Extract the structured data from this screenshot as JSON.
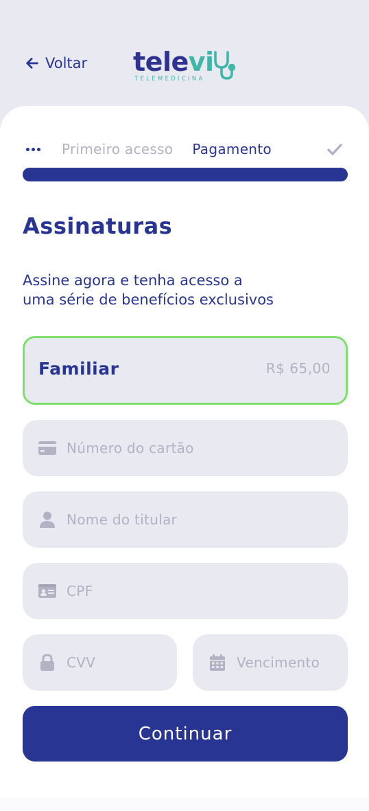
{
  "header": {
    "back_label": "Voltar",
    "logo": {
      "wordmark_main": "tele",
      "wordmark_accent": "vi",
      "tagline": "TELEMEDICINA"
    }
  },
  "steps": {
    "previous": "Primeiro acesso",
    "current": "Pagamento",
    "progress_fraction": 1.0
  },
  "content": {
    "title": "Assinaturas",
    "subtitle_line1": "Assine agora e tenha acesso a",
    "subtitle_line2": "uma série de benefícios exclusivos"
  },
  "plan": {
    "name": "Familiar",
    "price": "R$ 65,00"
  },
  "form": {
    "card_number_placeholder": "Número do cartão",
    "holder_name_placeholder": "Nome do titular",
    "cpf_placeholder": "CPF",
    "cvv_placeholder": "CVV",
    "expiry_placeholder": "Vencimento"
  },
  "actions": {
    "continue_label": "Continuar"
  },
  "colors": {
    "primary": "#283593",
    "accent_teal": "#3fb6a8",
    "selected_border": "#7ee06b",
    "field_bg": "#e9e9f1",
    "placeholder": "#b2b2c4"
  }
}
